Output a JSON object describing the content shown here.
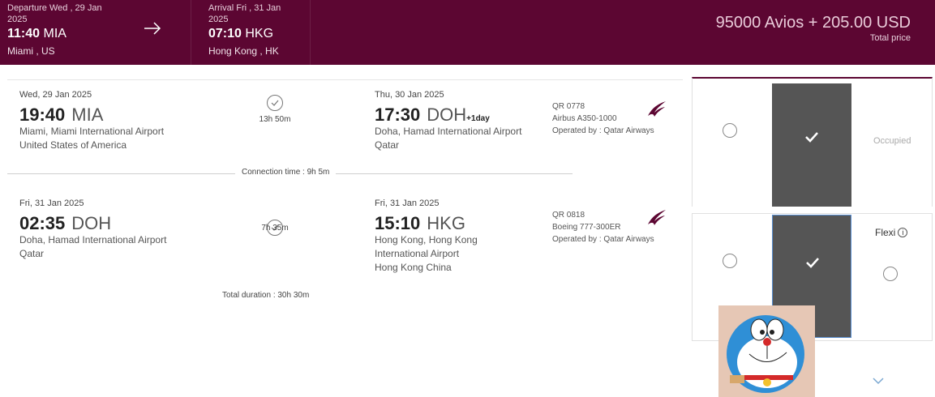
{
  "banner": {
    "departure": {
      "label": "Departure Wed , 29 Jan",
      "year": "2025",
      "time": "11:40",
      "code": "MIA",
      "city": "Miami , US"
    },
    "arrival": {
      "label": "Arrival Fri , 31 Jan",
      "year": "2025",
      "time": "07:10",
      "code": "HKG",
      "city": "Hong Kong , HK"
    },
    "price": "95000 Avios + 205.00 USD",
    "price_label": "Total price"
  },
  "segments": [
    {
      "dep_date": "Wed, 29 Jan 2025",
      "dep_time": "19:40",
      "dep_code": "MIA",
      "dep_airport_1": "Miami, Miami International Airport",
      "dep_airport_2": "United States of America",
      "duration": "13h 50m",
      "arr_date": "Thu, 30 Jan 2025",
      "arr_time": "17:30",
      "arr_code": "DOH",
      "arr_plus": "+1day",
      "arr_airport_1": "Doha, Hamad International Airport",
      "arr_airport_2": "Qatar",
      "arr_airport_3": "",
      "flight": "QR 0778",
      "aircraft": "Airbus A350-1000",
      "operator": "Operated by : Qatar Airways"
    },
    {
      "dep_date": "Fri, 31 Jan 2025",
      "dep_time": "02:35",
      "dep_code": "DOH",
      "dep_airport_1": "Doha, Hamad International Airport",
      "dep_airport_2": "Qatar",
      "duration": "7h 35m",
      "arr_date": "Fri, 31 Jan 2025",
      "arr_time": "15:10",
      "arr_code": "HKG",
      "arr_plus": "",
      "arr_airport_1": "Hong Kong, Hong Kong",
      "arr_airport_2": "International Airport",
      "arr_airport_3": "Hong Kong China",
      "flight": "QR 0818",
      "aircraft": "Boeing 777-300ER",
      "operator": "Operated by : Qatar Airways"
    }
  ],
  "connection": "Connection time : 9h 5m",
  "total_duration": "Total duration : 30h 30m",
  "fare_panel": {
    "occupied": "Occupied",
    "flexi": "Flexi",
    "info_glyph": "i"
  },
  "colors": {
    "brand": "#5c0632",
    "tile": "#555555",
    "price_text": "#e9cbd9"
  },
  "icons": [
    "arrow-right-icon",
    "clock-icon",
    "qatar-airways-logo-icon",
    "checkmark-icon",
    "info-icon",
    "chevron-down-icon"
  ]
}
